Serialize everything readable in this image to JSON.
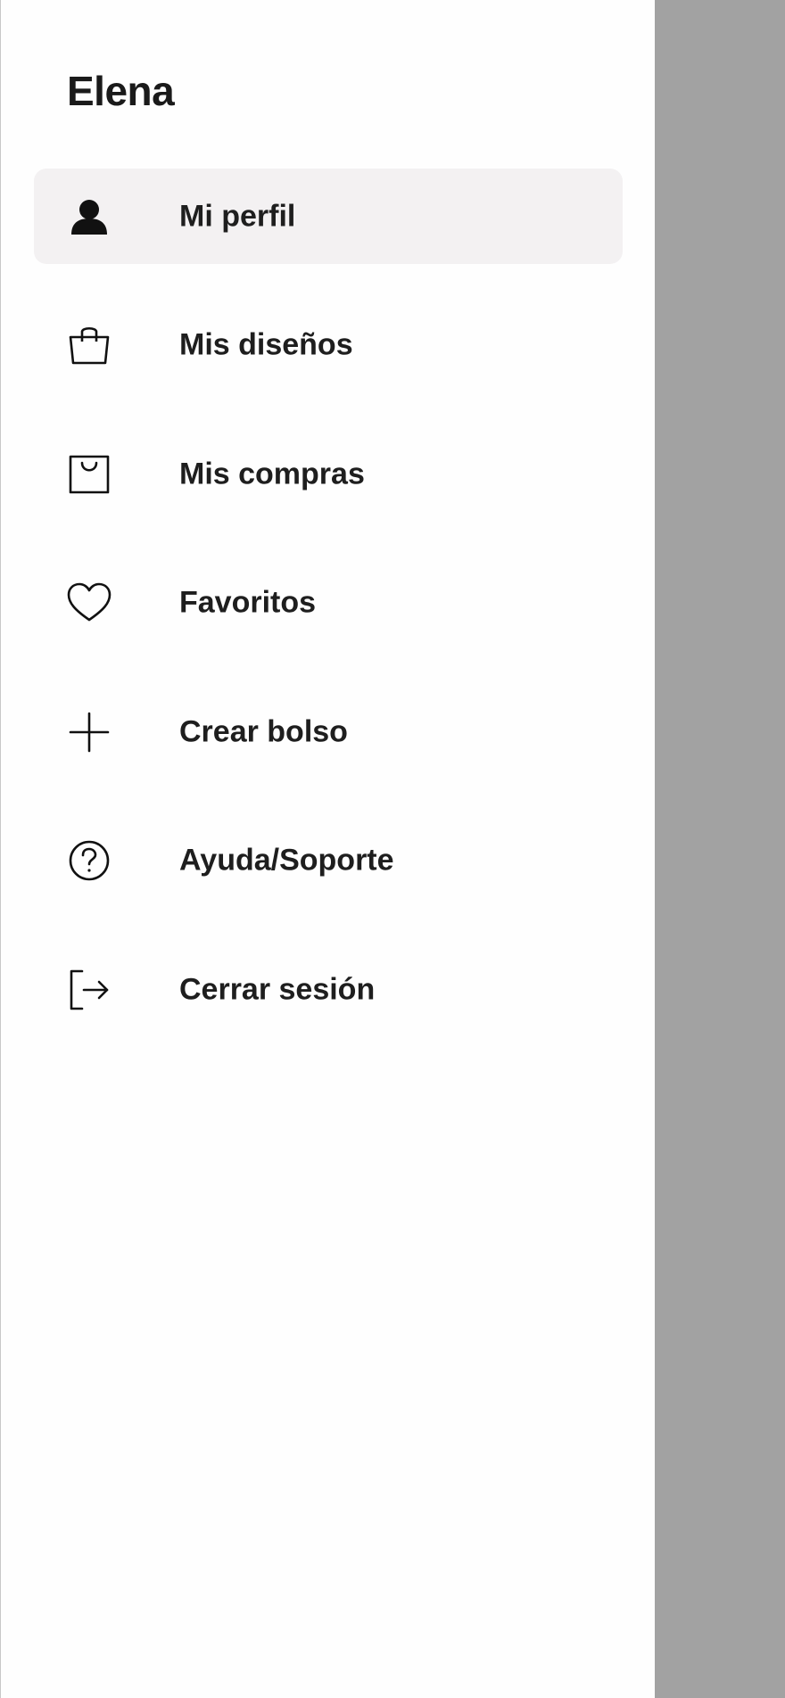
{
  "drawer": {
    "user_name": "Elena",
    "active_item": 0,
    "items": [
      {
        "label": "Mi perfil",
        "icon": "person-icon"
      },
      {
        "label": "Mis diseños",
        "icon": "shopping-bag-icon"
      },
      {
        "label": "Mis compras",
        "icon": "purchases-icon"
      },
      {
        "label": "Favoritos",
        "icon": "heart-icon"
      },
      {
        "label": "Crear bolso",
        "icon": "plus-icon"
      },
      {
        "label": "Ayuda/Soporte",
        "icon": "help-icon"
      },
      {
        "label": "Cerrar sesión",
        "icon": "logout-icon"
      }
    ]
  },
  "colors": {
    "drawer_background": "#fefefe",
    "active_item_background": "#f3f1f2",
    "scrim": "#a2a2a2",
    "text": "#1e1e1e"
  }
}
